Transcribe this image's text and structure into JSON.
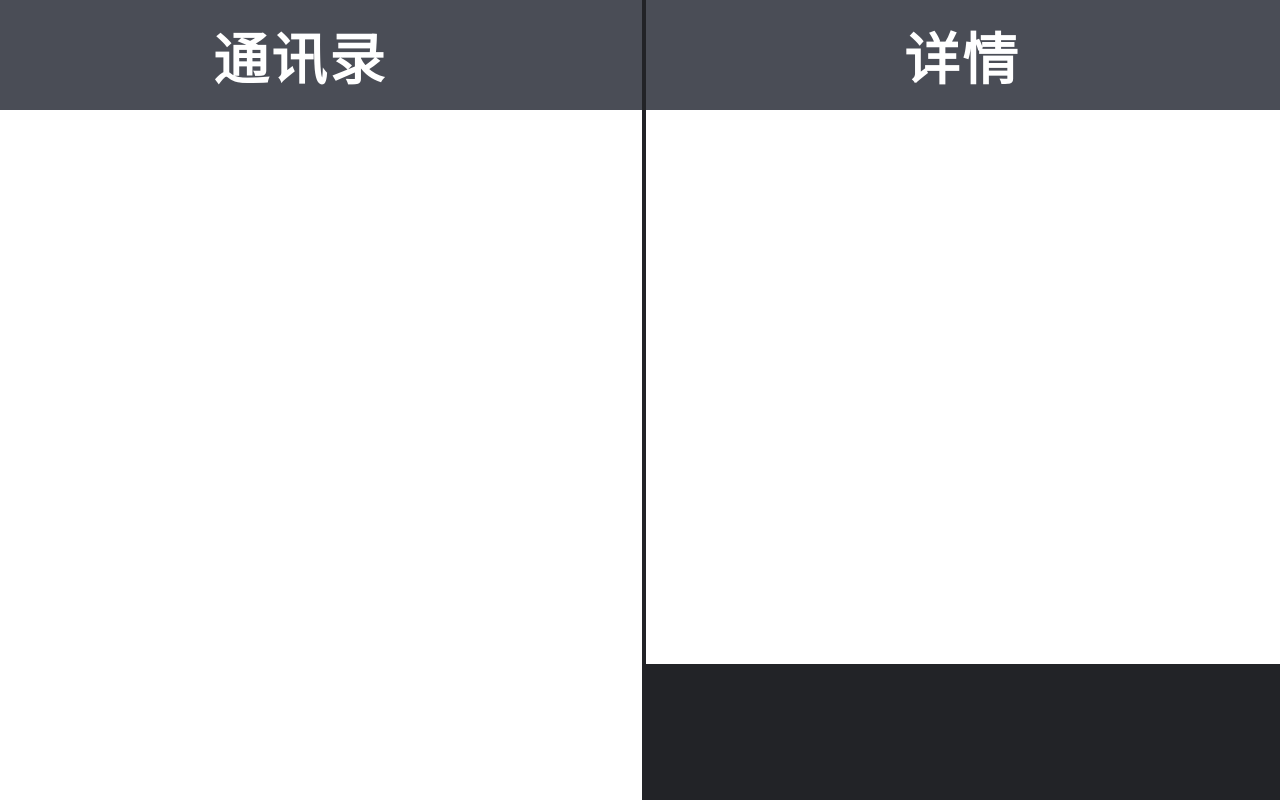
{
  "contacts_pane": {
    "title": "通讯录"
  },
  "detail_pane": {
    "title": "详情"
  },
  "colors": {
    "header_bg": "#4a4d56",
    "header_text": "#ffffff",
    "divider": "#222327",
    "footer_bg": "#222327",
    "content_bg": "#ffffff"
  }
}
